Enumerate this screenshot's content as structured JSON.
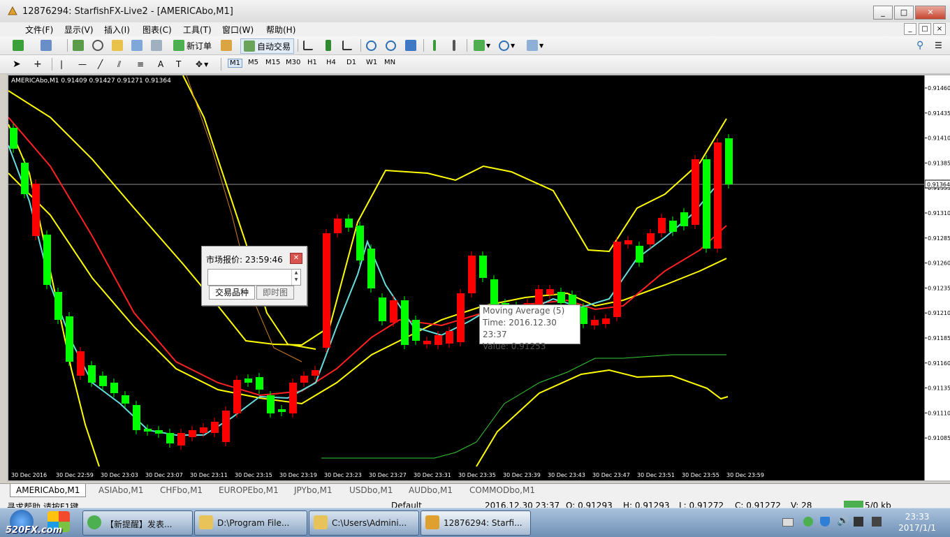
{
  "window": {
    "title": "12876294: StarfishFX-Live2 - [AMERICAbo,M1]"
  },
  "window_buttons": [
    "_",
    "□",
    "✕"
  ],
  "menu": [
    "文件(F)",
    "显示(V)",
    "插入(I)",
    "图表(C)",
    "工具(T)",
    "窗口(W)",
    "帮助(H)"
  ],
  "child_window_buttons": [
    "_",
    "□",
    "×"
  ],
  "toolbar": {
    "new_order": "新订单",
    "auto_trade": "自动交易"
  },
  "timeframes": [
    "M1",
    "M5",
    "M15",
    "M30",
    "H1",
    "H4",
    "D1",
    "W1",
    "MN"
  ],
  "draw_tools": [
    "A",
    "T"
  ],
  "chart": {
    "symbol_header": "AMERICAbo,M1  0.91409 0.91427 0.91271 0.91364",
    "current_price": "0.91364",
    "price_labels": [
      "0.91460",
      "0.91435",
      "0.91410",
      "0.91385",
      "0.91335",
      "0.91310",
      "0.91285",
      "0.91260",
      "0.91235",
      "0.91210",
      "0.91185",
      "0.91160",
      "0.91135",
      "0.91110",
      "0.91085"
    ],
    "time_labels": [
      "30 Dec 2016",
      "30 Dec 22:59",
      "30 Dec 23:03",
      "30 Dec 23:07",
      "30 Dec 23:11",
      "30 Dec 23:15",
      "30 Dec 23:19",
      "30 Dec 23:23",
      "30 Dec 23:27",
      "30 Dec 23:31",
      "30 Dec 23:35",
      "30 Dec 23:39",
      "30 Dec 23:43",
      "30 Dec 23:47",
      "30 Dec 23:51",
      "30 Dec 23:55",
      "30 Dec 23:59"
    ],
    "colors": {
      "bull": "#00ff00",
      "bear": "#ff0000",
      "ma_fast": "#66dddd",
      "ma_slow": "#ff2222",
      "bands": "#ffff00",
      "sar": "#33cc33",
      "background": "#000000"
    }
  },
  "market_popup": {
    "title": "市场报价: 23:59:46",
    "tab_symbols": "交易品种",
    "tab_chart": "即时图",
    "scroll_up": "▲",
    "scroll_down": "▼"
  },
  "tooltip": {
    "name": "Moving Average (5)",
    "time": "Time: 2016.12.30 23:37",
    "value": "Value: 0.91253"
  },
  "symbol_tabs": [
    "AMERICAbo,M1",
    "ASIAbo,M1",
    "CHFbo,M1",
    "EUROPEbo,M1",
    "JPYbo,M1",
    "USDbo,M1",
    "AUDbo,M1",
    "COMMODbo,M1"
  ],
  "status": {
    "help": "寻求帮助,请按F1键",
    "profile": "Default",
    "datetime": "2016.12.30 23:37",
    "open": "O: 0.91293",
    "high": "H: 0.91293",
    "low": "L: 0.91272",
    "close": "C: 0.91272",
    "volume": "V: 28",
    "traffic": "5/0 kb"
  },
  "taskbar": {
    "logo": "520FX.com",
    "tasks": [
      "【新提醒】发表...",
      "D:\\Program File...",
      "C:\\Users\\Admini...",
      "12876294: Starfi..."
    ],
    "clock_time": "23:33",
    "clock_date": "2017/1/1"
  }
}
